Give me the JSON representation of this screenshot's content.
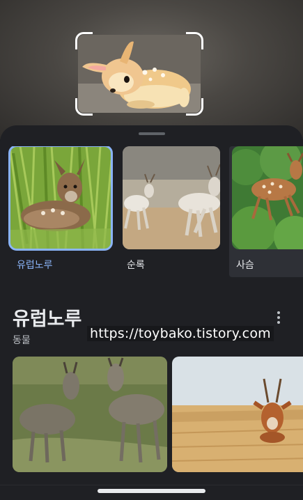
{
  "camera": {
    "subject_icon": "fawn-figurine-image"
  },
  "sheet": {
    "matches": [
      {
        "label": "유럽노루",
        "image": "roe-deer-fawn-image",
        "selected": true
      },
      {
        "label": "순록",
        "image": "reindeer-running-image",
        "selected": false
      },
      {
        "label": "사슴",
        "image": "spotted-deer-image",
        "selected": false
      }
    ],
    "entity": {
      "title": "유럽노루",
      "subtitle": "동물"
    },
    "results": [
      {
        "image": "two-roe-deer-image"
      },
      {
        "image": "roe-deer-field-image"
      }
    ]
  },
  "watermark": "https://toybako.tistory.com",
  "colors": {
    "accent": "#8ab4f8",
    "sheet": "#1f2024"
  }
}
